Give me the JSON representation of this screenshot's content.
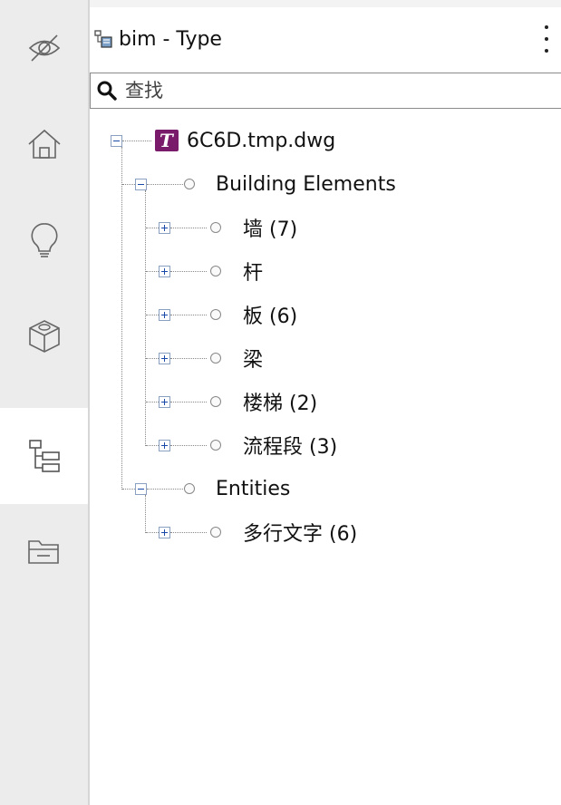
{
  "sidebar": {
    "items": [
      {
        "name": "visibility",
        "icon": "eye-off-icon"
      },
      {
        "name": "home",
        "icon": "home-icon"
      },
      {
        "name": "ideas",
        "icon": "lightbulb-icon"
      },
      {
        "name": "model",
        "icon": "cube-icon"
      },
      {
        "name": "tree",
        "icon": "hierarchy-icon",
        "active": true
      },
      {
        "name": "files",
        "icon": "folder-icon"
      }
    ]
  },
  "header": {
    "title": "bim - Type",
    "icon": "type-tree-icon",
    "menu_icon": "more-vertical-icon"
  },
  "search": {
    "placeholder": "查找",
    "value": "",
    "icon": "search-icon"
  },
  "tree": {
    "root": {
      "label": "6C6D.tmp.dwg",
      "icon": "dwg-file-icon"
    },
    "groups": [
      {
        "label": "Building Elements",
        "children": [
          {
            "label": "墙 (7)"
          },
          {
            "label": "杆"
          },
          {
            "label": "板 (6)"
          },
          {
            "label": "梁"
          },
          {
            "label": "楼梯 (2)"
          },
          {
            "label": "流程段 (3)"
          }
        ]
      },
      {
        "label": "Entities",
        "children": [
          {
            "label": "多行文字 (6)"
          }
        ]
      }
    ]
  },
  "colors": {
    "sidebar_bg": "#ececec",
    "toggle_blue": "#1a4aa8",
    "dwg_icon_purple": "#7a1a6a"
  }
}
